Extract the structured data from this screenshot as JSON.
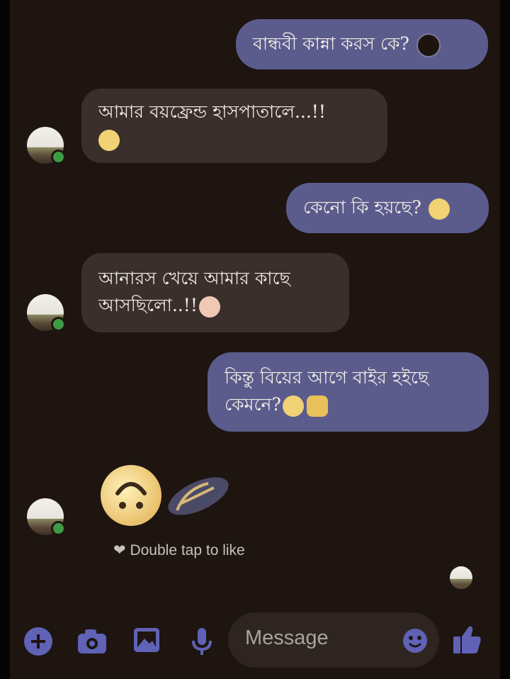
{
  "messages": [
    {
      "direction": "sent",
      "text": "বান্ধবী কান্না করস কে?",
      "emoji": "dark-face-emoji"
    },
    {
      "direction": "received",
      "line1": "আমার বয়ফ্রেন্ড হাসপাতালে...!!",
      "emoji": "grinning-sweat-emoji"
    },
    {
      "direction": "sent",
      "text": "কেনো কি হয়ছে?",
      "emoji": "eye-roll-emoji"
    },
    {
      "direction": "received",
      "line1": "আনারস খেয়ে আমার কাছে",
      "line2": "আসছিলো..!!",
      "emoji": "flushed-emoji"
    },
    {
      "direction": "sent",
      "line1": "কিন্তু বিয়ের আগে বাইর হইছে",
      "line2": "কেমনে?",
      "emoji": "smile-wave-emoji"
    }
  ],
  "reactions": {
    "emoji": "upside-down-face-emoji",
    "sticker": "slipper-emoji"
  },
  "like_hint": "Double tap to like",
  "composer": {
    "placeholder": "Message"
  },
  "colors": {
    "sent_bubble": "#5b5c8c",
    "received_bubble": "#3a2f2a",
    "background": "#1e1511",
    "accent": "#5f62b5"
  }
}
